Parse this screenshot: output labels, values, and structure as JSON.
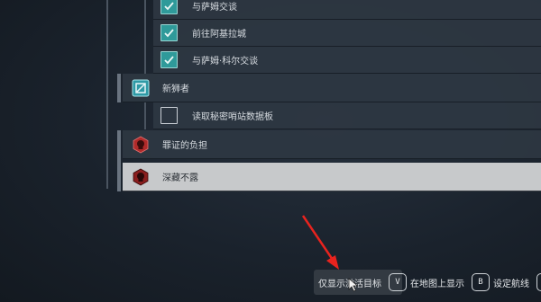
{
  "quests": {
    "sub_top": [
      {
        "label": "与萨姆交谈",
        "checked": true
      },
      {
        "label": "前往阿基拉城",
        "checked": true
      },
      {
        "label": "与萨姆·科尔交谈",
        "checked": true
      }
    ],
    "main_1": {
      "label": "新狮者",
      "icon": "cube-icon"
    },
    "sub_mid": [
      {
        "label": "读取秘密哨站数据板",
        "checked": false
      }
    ],
    "main_2": {
      "label": "罪证的负担",
      "icon": "faction-skull-icon"
    },
    "main_3": {
      "label": "深藏不露",
      "icon": "faction-skull-icon",
      "selected": true
    }
  },
  "hints": [
    {
      "text": "仅显示激活目标",
      "key": "V"
    },
    {
      "text": "在地图上显示",
      "key": "B"
    },
    {
      "text": "设定航线",
      "key": "R"
    }
  ],
  "colors": {
    "accent_teal": "#2f9a9a",
    "faction_red": "#b02a2a",
    "annotation_red": "#e8231e"
  }
}
